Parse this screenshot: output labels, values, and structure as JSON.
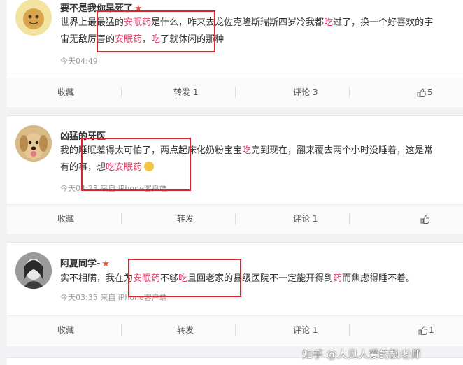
{
  "comments": [
    {
      "username": "要不是我你早死了",
      "text_line1": [
        "世界上最",
        "最猛的",
        "安眠药",
        "是什么，咋来去龙佐克隆斯瑞斯四岁冷我都",
        "吃",
        "过了，换一个好喜欢的宇"
      ],
      "text_line2": [
        "宙无敌厉害的",
        "安眠药",
        "，",
        "吃",
        "了就休闲的那种"
      ],
      "meta": "今天04:49",
      "actions": {
        "collect": "收藏",
        "repost": "转发 1",
        "comment": "评论 3",
        "like": "5"
      }
    },
    {
      "username": "凶猛的牙医",
      "text_line1": [
        "我的睡眠差得太可怕了，两点起床化奶粉宝宝",
        "吃",
        "完到现在，翻来覆去两个小时没睡着，这是常"
      ],
      "text_line2": [
        "有的事，想",
        "吃安眠药",
        ""
      ],
      "meta": "今天04:23 来自 iPhone客户端",
      "actions": {
        "collect": "收藏",
        "repost": "转发",
        "comment": "评论 1",
        "like": ""
      }
    },
    {
      "username": "阿夏同学-",
      "text_line1": [
        "实不相瞒，我在为",
        "安眠药",
        "不够",
        "吃",
        "且回老家的县级医院不一定能开得到",
        "药",
        "而焦虑得睡不着。"
      ],
      "meta": "今天03:35 来自 iPhone客户端",
      "actions": {
        "collect": "收藏",
        "repost": "转发",
        "comment": "评论 1",
        "like": "1"
      }
    }
  ],
  "watermark": "知乎 @人见人爱的飘老师",
  "colors": {
    "highlight": "#e6416e",
    "box": "#d9262c",
    "star": "#e8543f"
  },
  "icons": {
    "star": "star-icon",
    "like": "thumbs-up-icon"
  }
}
